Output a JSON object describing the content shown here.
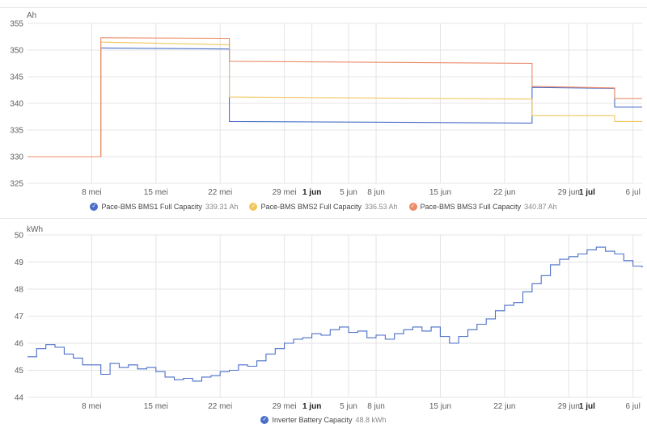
{
  "chart_data": [
    {
      "type": "line",
      "ylabel": "Ah",
      "ylim": [
        325,
        355
      ],
      "yticks": [
        325,
        330,
        335,
        340,
        345,
        350,
        355
      ],
      "xlim": [
        "2024-05-01",
        "2024-07-07"
      ],
      "xticks": [
        {
          "date": "2024-05-08",
          "label": "8 mei",
          "bold": false
        },
        {
          "date": "2024-05-15",
          "label": "15 mei",
          "bold": false
        },
        {
          "date": "2024-05-22",
          "label": "22 mei",
          "bold": false
        },
        {
          "date": "2024-05-29",
          "label": "29 mei",
          "bold": false
        },
        {
          "date": "2024-06-01",
          "label": "1 jun",
          "bold": true
        },
        {
          "date": "2024-06-05",
          "label": "5 jun",
          "bold": false
        },
        {
          "date": "2024-06-08",
          "label": "8 jun",
          "bold": false
        },
        {
          "date": "2024-06-15",
          "label": "15 jun",
          "bold": false
        },
        {
          "date": "2024-06-22",
          "label": "22 jun",
          "bold": false
        },
        {
          "date": "2024-06-29",
          "label": "29 jun",
          "bold": false
        },
        {
          "date": "2024-07-01",
          "label": "1 jul",
          "bold": true
        },
        {
          "date": "2024-07-06",
          "label": "6 jul",
          "bold": false
        }
      ],
      "grid": true,
      "legend_position": "bottom-center",
      "series": [
        {
          "name": "Pace-BMS BMS1 Full Capacity",
          "value_label": "339.31 Ah",
          "color": "#4a6fc8",
          "points": [
            [
              "2024-05-01",
              330.0
            ],
            [
              "2024-05-09",
              330.0
            ],
            [
              "2024-05-09",
              350.4
            ],
            [
              "2024-05-23",
              350.2
            ],
            [
              "2024-05-23",
              336.6
            ],
            [
              "2024-06-25",
              336.3
            ],
            [
              "2024-06-25",
              343.0
            ],
            [
              "2024-07-04",
              342.8
            ],
            [
              "2024-07-04",
              339.3
            ],
            [
              "2024-07-07",
              339.3
            ]
          ]
        },
        {
          "name": "Pace-BMS BMS2 Full Capacity",
          "value_label": "336.53 Ah",
          "color": "#f0c75e",
          "points": [
            [
              "2024-05-01",
              330.0
            ],
            [
              "2024-05-09",
              330.0
            ],
            [
              "2024-05-09",
              351.5
            ],
            [
              "2024-05-23",
              351.0
            ],
            [
              "2024-05-23",
              341.2
            ],
            [
              "2024-06-25",
              340.8
            ],
            [
              "2024-06-25",
              337.7
            ],
            [
              "2024-07-04",
              337.7
            ],
            [
              "2024-07-04",
              336.6
            ],
            [
              "2024-07-07",
              336.6
            ]
          ]
        },
        {
          "name": "Pace-BMS BMS3 Full Capacity",
          "value_label": "340.87 Ah",
          "color": "#ec8b6a",
          "points": [
            [
              "2024-05-01",
              330.0
            ],
            [
              "2024-05-09",
              330.0
            ],
            [
              "2024-05-09",
              352.3
            ],
            [
              "2024-05-23",
              352.2
            ],
            [
              "2024-05-23",
              347.9
            ],
            [
              "2024-06-25",
              347.5
            ],
            [
              "2024-06-25",
              343.2
            ],
            [
              "2024-07-04",
              342.9
            ],
            [
              "2024-07-04",
              340.9
            ],
            [
              "2024-07-07",
              340.9
            ]
          ]
        }
      ]
    },
    {
      "type": "line",
      "ylabel": "kWh",
      "ylim": [
        44,
        50
      ],
      "yticks": [
        44,
        45,
        46,
        47,
        48,
        49,
        50
      ],
      "xlim": [
        "2024-05-01",
        "2024-07-07"
      ],
      "xticks": [
        {
          "date": "2024-05-08",
          "label": "8 mei",
          "bold": false
        },
        {
          "date": "2024-05-15",
          "label": "15 mei",
          "bold": false
        },
        {
          "date": "2024-05-22",
          "label": "22 mei",
          "bold": false
        },
        {
          "date": "2024-05-29",
          "label": "29 mei",
          "bold": false
        },
        {
          "date": "2024-06-01",
          "label": "1 jun",
          "bold": true
        },
        {
          "date": "2024-06-05",
          "label": "5 jun",
          "bold": false
        },
        {
          "date": "2024-06-08",
          "label": "8 jun",
          "bold": false
        },
        {
          "date": "2024-06-15",
          "label": "15 jun",
          "bold": false
        },
        {
          "date": "2024-06-22",
          "label": "22 jun",
          "bold": false
        },
        {
          "date": "2024-06-29",
          "label": "29 jun",
          "bold": false
        },
        {
          "date": "2024-07-01",
          "label": "1 jul",
          "bold": true
        },
        {
          "date": "2024-07-06",
          "label": "6 jul",
          "bold": false
        }
      ],
      "grid": true,
      "legend_position": "bottom-center",
      "series": [
        {
          "name": "Inverter Battery Capacity",
          "value_label": "48.8 kWh",
          "color": "#4a6fc8",
          "step": true,
          "points": [
            [
              "2024-05-01",
              45.5
            ],
            [
              "2024-05-02",
              45.8
            ],
            [
              "2024-05-03",
              45.95
            ],
            [
              "2024-05-04",
              45.85
            ],
            [
              "2024-05-05",
              45.6
            ],
            [
              "2024-05-06",
              45.45
            ],
            [
              "2024-05-07",
              45.2
            ],
            [
              "2024-05-08",
              45.2
            ],
            [
              "2024-05-09",
              44.85
            ],
            [
              "2024-05-10",
              45.25
            ],
            [
              "2024-05-11",
              45.1
            ],
            [
              "2024-05-12",
              45.2
            ],
            [
              "2024-05-13",
              45.05
            ],
            [
              "2024-05-14",
              45.1
            ],
            [
              "2024-05-15",
              44.95
            ],
            [
              "2024-05-16",
              44.75
            ],
            [
              "2024-05-17",
              44.65
            ],
            [
              "2024-05-18",
              44.7
            ],
            [
              "2024-05-19",
              44.6
            ],
            [
              "2024-05-20",
              44.75
            ],
            [
              "2024-05-21",
              44.8
            ],
            [
              "2024-05-22",
              44.95
            ],
            [
              "2024-05-23",
              45.0
            ],
            [
              "2024-05-24",
              45.2
            ],
            [
              "2024-05-25",
              45.15
            ],
            [
              "2024-05-26",
              45.35
            ],
            [
              "2024-05-27",
              45.6
            ],
            [
              "2024-05-28",
              45.8
            ],
            [
              "2024-05-29",
              46.0
            ],
            [
              "2024-05-30",
              46.15
            ],
            [
              "2024-05-31",
              46.2
            ],
            [
              "2024-06-01",
              46.35
            ],
            [
              "2024-06-02",
              46.3
            ],
            [
              "2024-06-03",
              46.5
            ],
            [
              "2024-06-04",
              46.6
            ],
            [
              "2024-06-05",
              46.4
            ],
            [
              "2024-06-06",
              46.45
            ],
            [
              "2024-06-07",
              46.2
            ],
            [
              "2024-06-08",
              46.3
            ],
            [
              "2024-06-09",
              46.15
            ],
            [
              "2024-06-10",
              46.35
            ],
            [
              "2024-06-11",
              46.5
            ],
            [
              "2024-06-12",
              46.6
            ],
            [
              "2024-06-13",
              46.45
            ],
            [
              "2024-06-14",
              46.6
            ],
            [
              "2024-06-15",
              46.25
            ],
            [
              "2024-06-16",
              46.0
            ],
            [
              "2024-06-17",
              46.25
            ],
            [
              "2024-06-18",
              46.5
            ],
            [
              "2024-06-19",
              46.7
            ],
            [
              "2024-06-20",
              46.9
            ],
            [
              "2024-06-21",
              47.2
            ],
            [
              "2024-06-22",
              47.4
            ],
            [
              "2024-06-23",
              47.5
            ],
            [
              "2024-06-24",
              47.9
            ],
            [
              "2024-06-25",
              48.2
            ],
            [
              "2024-06-26",
              48.5
            ],
            [
              "2024-06-27",
              48.9
            ],
            [
              "2024-06-28",
              49.1
            ],
            [
              "2024-06-29",
              49.2
            ],
            [
              "2024-06-30",
              49.3
            ],
            [
              "2024-07-01",
              49.45
            ],
            [
              "2024-07-02",
              49.55
            ],
            [
              "2024-07-03",
              49.4
            ],
            [
              "2024-07-04",
              49.3
            ],
            [
              "2024-07-05",
              49.05
            ],
            [
              "2024-07-06",
              48.85
            ],
            [
              "2024-07-07",
              48.8
            ]
          ]
        }
      ]
    }
  ]
}
